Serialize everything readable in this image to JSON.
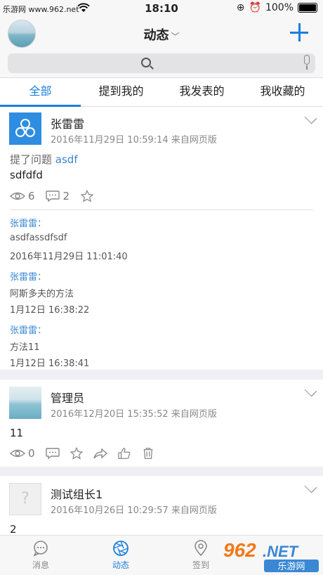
{
  "status_bar": {
    "carrier": "乐游网 www.962.net",
    "time": "18:10",
    "battery": "100%"
  },
  "nav": {
    "title": "动态",
    "chevron": "﹀"
  },
  "tabs": [
    {
      "label": "全部"
    },
    {
      "label": "提到我的"
    },
    {
      "label": "我发表的"
    },
    {
      "label": "我收藏的"
    }
  ],
  "posts": [
    {
      "author": "张雷雷",
      "meta": "2016年11月29日 10:59:14 来自网页版",
      "question_prefix": "提了问题",
      "question_link": "asdf",
      "body": "sdfdfd",
      "views": "6",
      "comments_count": "2",
      "comments": [
        {
          "name": "张雷雷：",
          "text": "asdfassdfsdf",
          "time": "2016年11月29日 11:01:40"
        },
        {
          "name": "张雷雷：",
          "text": "阿斯多夫的方法",
          "time": "1月12日 16:38:22"
        },
        {
          "name": "张雷雷：",
          "text": "方法11",
          "time": "1月12日 16:38:41"
        }
      ]
    },
    {
      "author": "管理员",
      "meta": "2016年12月20日 15:35:52 来自网页版",
      "body": "11",
      "views": "0"
    },
    {
      "author": "测试组长1",
      "meta": "2016年10月26日 10:29:57 来自网页版",
      "body": "2"
    }
  ],
  "tabbar": {
    "items": [
      {
        "label": "消息"
      },
      {
        "label": "动态"
      },
      {
        "label": "签到"
      }
    ]
  },
  "watermark": {
    "brand": "962",
    "domain": ".NET",
    "name": "乐游网"
  },
  "colors": {
    "accent": "#1a7fde",
    "link": "#3a87d4"
  }
}
